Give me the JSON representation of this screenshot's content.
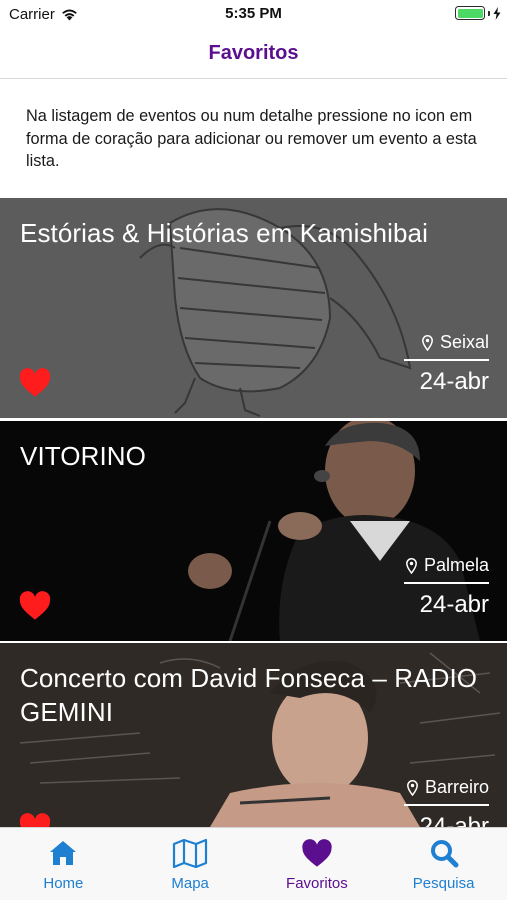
{
  "status_bar": {
    "carrier": "Carrier",
    "time": "5:35 PM",
    "battery_level": 1.0,
    "battery_color": "#4cd964"
  },
  "header": {
    "title": "Favoritos",
    "title_color": "#5b0f8f"
  },
  "intro": {
    "text": "Na listagem de eventos ou num detalhe pressione no icon em forma de coração para adicionar ou remover um evento a esta lista."
  },
  "events": [
    {
      "title": "Estórias & Histórias em Kamishibai",
      "location": "Seixal",
      "date": "24-abr",
      "favorite": true
    },
    {
      "title": "VITORINO",
      "location": "Palmela",
      "date": "24-abr",
      "favorite": true
    },
    {
      "title": "Concerto com David Fonseca – RADIO GEMINI",
      "location": "Barreiro",
      "date": "24-abr",
      "favorite": true
    }
  ],
  "tab_bar": {
    "active_color": "#5b0f8f",
    "inactive_color": "#1f7fd1",
    "tabs": [
      {
        "label": "Home",
        "icon": "home-icon",
        "active": false
      },
      {
        "label": "Mapa",
        "icon": "map-icon",
        "active": false
      },
      {
        "label": "Favoritos",
        "icon": "heart-icon",
        "active": true
      },
      {
        "label": "Pesquisa",
        "icon": "search-icon",
        "active": false
      }
    ]
  },
  "colors": {
    "heart": "#ff1c1c"
  }
}
